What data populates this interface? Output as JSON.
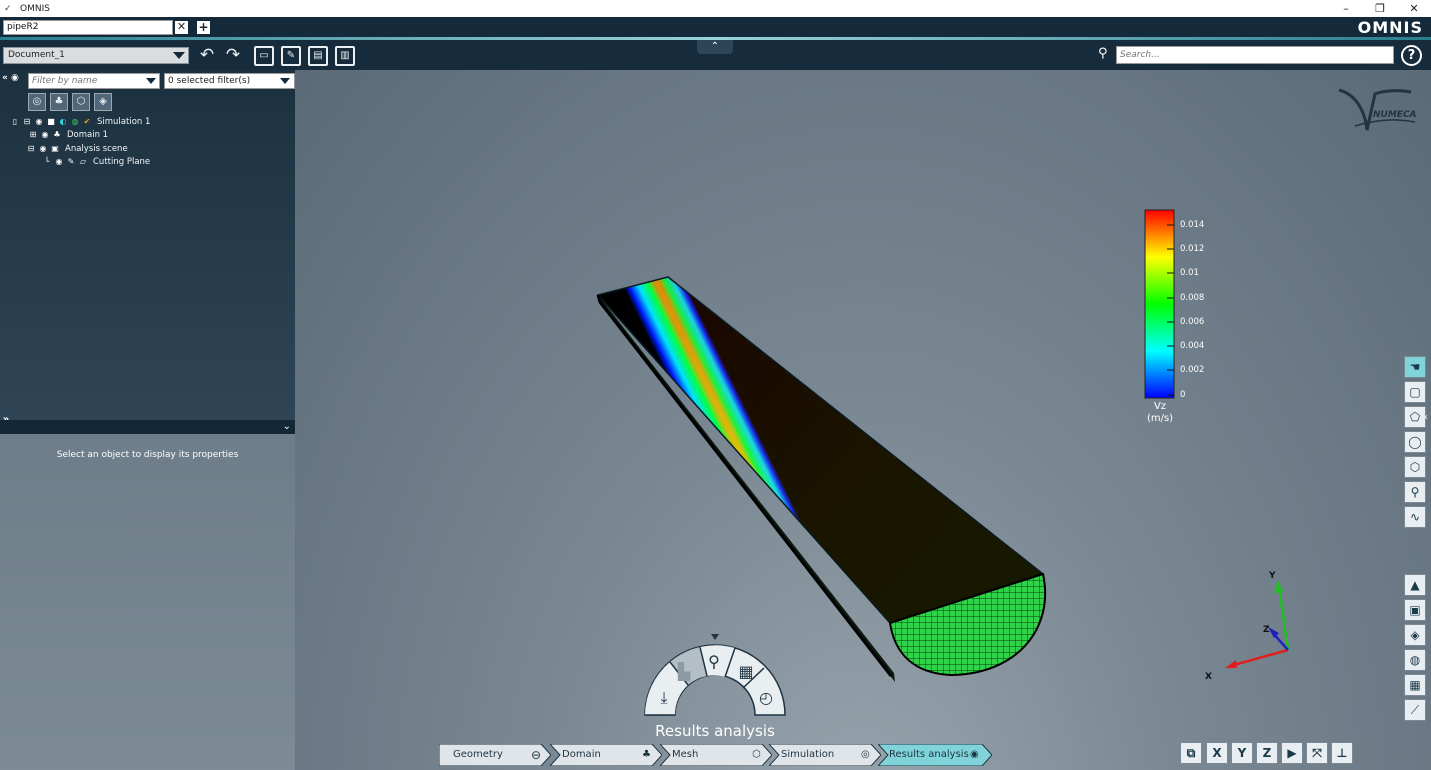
{
  "window": {
    "title": "OMNIS",
    "minimize": "–",
    "restore": "❐",
    "close": "✕"
  },
  "tab": {
    "name": "pipeR2",
    "close": "✕",
    "add": "+"
  },
  "brand": {
    "logo": "OMNIS",
    "accent": "#6ac6cf"
  },
  "toolbar": {
    "document": "Document_1",
    "collapse": "⌃",
    "search_placeholder": "Search...",
    "help": "?"
  },
  "tree": {
    "panel_toggle": "«",
    "filter_placeholder": "Filter by name",
    "selected_filters": "0 selected filter(s)",
    "items": [
      {
        "label": "Simulation 1"
      },
      {
        "label": "Domain 1"
      },
      {
        "label": "Analysis scene"
      },
      {
        "label": "Cutting Plane"
      }
    ]
  },
  "properties": {
    "message": "Select an object to display its properties",
    "expand": "»",
    "collapse": "⌄"
  },
  "watermark": "NUMECA",
  "legend": {
    "title": "Vz",
    "unit": "(m/s)",
    "ticks": [
      "0.014",
      "0.012",
      "0.01",
      "0.008",
      "0.006",
      "0.004",
      "0.002",
      "0"
    ],
    "colors": [
      "#ff0000",
      "#ffff00",
      "#00ff00",
      "#00ffff",
      "#0000ff"
    ]
  },
  "triad": {
    "x": "X",
    "y": "Y",
    "z": "Z"
  },
  "view_buttons": [
    "X",
    "Y",
    "Z"
  ],
  "wheel": {
    "title": "Results analysis"
  },
  "workflow": {
    "steps": [
      {
        "label": "Geometry"
      },
      {
        "label": "Domain"
      },
      {
        "label": "Mesh"
      },
      {
        "label": "Simulation"
      },
      {
        "label": "Results analysis"
      }
    ],
    "active_color": "#7fd3d9"
  }
}
